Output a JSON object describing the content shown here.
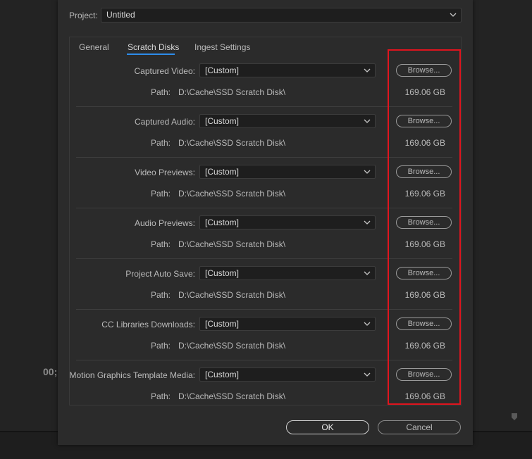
{
  "background": {
    "timecode": "00;"
  },
  "project": {
    "label": "Project:",
    "value": "Untitled"
  },
  "tabs": [
    {
      "label": "General",
      "active": false
    },
    {
      "label": "Scratch Disks",
      "active": true
    },
    {
      "label": "Ingest Settings",
      "active": false
    }
  ],
  "path_label": "Path:",
  "browse_label": "Browse...",
  "rows": [
    {
      "label": "Captured Video:",
      "value": "[Custom]",
      "path": "D:\\Cache\\SSD Scratch Disk\\",
      "size": "169.06 GB"
    },
    {
      "label": "Captured Audio:",
      "value": "[Custom]",
      "path": "D:\\Cache\\SSD Scratch Disk\\",
      "size": "169.06 GB"
    },
    {
      "label": "Video Previews:",
      "value": "[Custom]",
      "path": "D:\\Cache\\SSD Scratch Disk\\",
      "size": "169.06 GB"
    },
    {
      "label": "Audio Previews:",
      "value": "[Custom]",
      "path": "D:\\Cache\\SSD Scratch Disk\\",
      "size": "169.06 GB"
    },
    {
      "label": "Project Auto Save:",
      "value": "[Custom]",
      "path": "D:\\Cache\\SSD Scratch Disk\\",
      "size": "169.06 GB"
    },
    {
      "label": "CC Libraries Downloads:",
      "value": "[Custom]",
      "path": "D:\\Cache\\SSD Scratch Disk\\",
      "size": "169.06 GB"
    },
    {
      "label": "Motion Graphics Template Media:",
      "value": "[Custom]",
      "path": "D:\\Cache\\SSD Scratch Disk\\",
      "size": "169.06 GB"
    }
  ],
  "footer": {
    "ok_label": "OK",
    "cancel_label": "Cancel"
  },
  "colors": {
    "accent": "#2d8ceb",
    "highlight_box": "#e0141e"
  }
}
